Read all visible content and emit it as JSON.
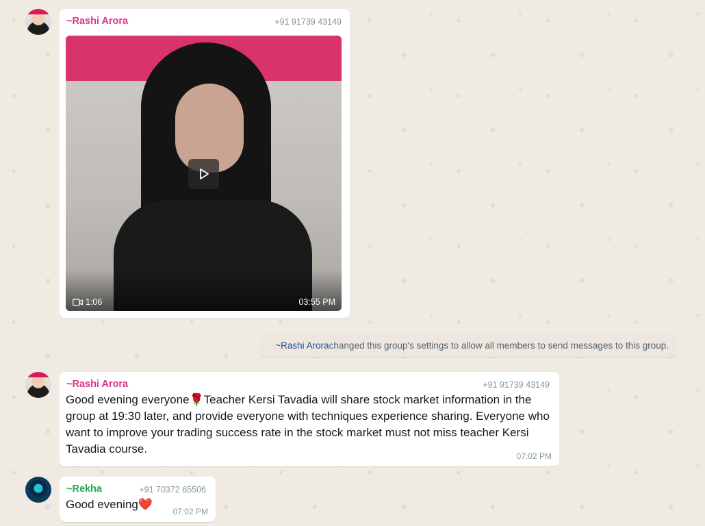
{
  "messages": [
    {
      "sender": "~Rashi Arora",
      "phone": "+91 91739 43149",
      "video": {
        "duration": "1:06",
        "time": "03:55 PM"
      }
    },
    {
      "sender": "~Rashi Arora",
      "phone": "+91 91739 43149",
      "text": "Good evening everyone🌹Teacher Kersi Tavadia  will share stock market information in the group at 19:30 later, and provide everyone with techniques experience sharing. Everyone who want to improve your trading success rate in the stock market must not miss teacher Kersi Tavadia course.",
      "time": "07:02 PM"
    },
    {
      "sender": "~Rekha",
      "phone": "+91 70372 65506",
      "text": "Good evening❤️",
      "time": "07:02 PM"
    }
  ],
  "system_notice": {
    "name": "~Rashi Arora",
    "text": " changed this group's settings to allow all members to send messages to this group."
  },
  "colors": {
    "background": "#efeae2",
    "sender_pink": "#e0318a",
    "sender_green": "#1fa855",
    "meta_gray": "#8696a0",
    "system_name_blue": "#1f4fa1"
  },
  "icons": [
    "play-icon",
    "video-camera-icon"
  ]
}
